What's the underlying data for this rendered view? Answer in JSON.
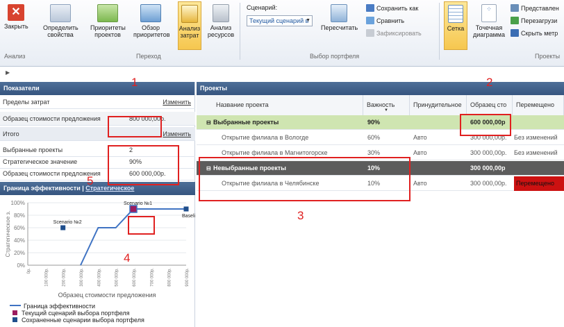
{
  "ribbon": {
    "buttons": [
      {
        "label": "Закрыть"
      },
      {
        "label": "Определить свойства"
      },
      {
        "label": "Приоритеты проектов"
      },
      {
        "label": "Обзор приоритетов"
      },
      {
        "label": "Анализ затрат"
      },
      {
        "label": "Анализ ресурсов"
      }
    ],
    "scenario_label": "Сценарий:",
    "scenario_value": "Текущий сценарий в",
    "recalc": "Пересчитать",
    "save_as": "Сохранить как",
    "compare": "Сравнить",
    "lock": "Зафиксировать",
    "grid": "Сетка",
    "scatter": "Точечная диаграмма",
    "views": "Представлен",
    "reload": "Перезагрузи",
    "hide_metrics": "Скрыть метр",
    "groups": {
      "analysis": "Анализ",
      "nav": "Переход",
      "portfolio": "Выбор портфеля",
      "projects": "Проекты"
    }
  },
  "left": {
    "header": "Показатели",
    "cost_limits": "Пределы затрат",
    "change1": "Изменить",
    "cost_sample": "Образец стоимости предложения",
    "cost_sample_val": "800 000,00р.",
    "total": "Итого",
    "change2": "Изменить",
    "selected": "Выбранные проекты",
    "selected_val": "2",
    "strategic": "Стратегическое значение",
    "strategic_val": "90%",
    "cost_sample2": "Образец стоимости предложения",
    "cost_sample2_val": "600 000,00р.",
    "frontier_title": "Граница эффективности",
    "frontier_link": "Стратегическое"
  },
  "chart_data": {
    "type": "line",
    "ylabel": "Стратегическое з.",
    "xlabel": "Образец стоимости предложения",
    "y_ticks": [
      "0%",
      "20%",
      "40%",
      "60%",
      "80%",
      "100%"
    ],
    "x_ticks": [
      "0р.",
      "100 000р.",
      "200 000р.",
      "300 000р.",
      "400 000р.",
      "500 000р.",
      "600 000р.",
      "700 000р.",
      "800 000р.",
      "900 000р."
    ],
    "series": [
      {
        "name": "Граница эффективности",
        "x": [
          300000,
          400000,
          500000,
          600000,
          800000,
          900000
        ],
        "y": [
          0,
          60,
          60,
          90,
          90,
          90
        ]
      }
    ],
    "points": [
      {
        "label": "Scenario №1",
        "x": 600000,
        "y": 90,
        "kind": "current"
      },
      {
        "label": "Scenario №2",
        "x": 200000,
        "y": 60,
        "kind": "saved"
      },
      {
        "label": "Baseline",
        "x": 900000,
        "y": 90,
        "kind": "saved"
      }
    ],
    "legend": [
      "Граница эффективности",
      "Текущий сценарий выбора портфеля",
      "Сохраненные сценарии выбора портфеля"
    ]
  },
  "right": {
    "header": "Проекты",
    "columns": [
      "Название проекта",
      "Важность",
      "Принудительное",
      "Образец сто",
      "Перемещено"
    ],
    "rows": [
      {
        "name": "Выбранные проекты",
        "imp": "90%",
        "forced": "",
        "cost": "600 000,00р",
        "moved": "",
        "kind": "group-sel"
      },
      {
        "name": "Открытие филиала в Вологде",
        "imp": "60%",
        "forced": "Авто",
        "cost": "300 000,00р.",
        "moved": "Без изменений",
        "kind": "row"
      },
      {
        "name": "Открытие филиала в Магнитогорске",
        "imp": "30%",
        "forced": "Авто",
        "cost": "300 000,00р.",
        "moved": "Без изменений",
        "kind": "row"
      },
      {
        "name": "Невыбранные проекты",
        "imp": "10%",
        "forced": "",
        "cost": "300 000,00р",
        "moved": "",
        "kind": "group-unsel"
      },
      {
        "name": "Открытие филиала в Челябинске",
        "imp": "10%",
        "forced": "Авто",
        "cost": "300 000,00р.",
        "moved": "Перемещено",
        "kind": "row-red"
      }
    ]
  },
  "callouts": [
    "1",
    "2",
    "3",
    "4",
    "5"
  ]
}
